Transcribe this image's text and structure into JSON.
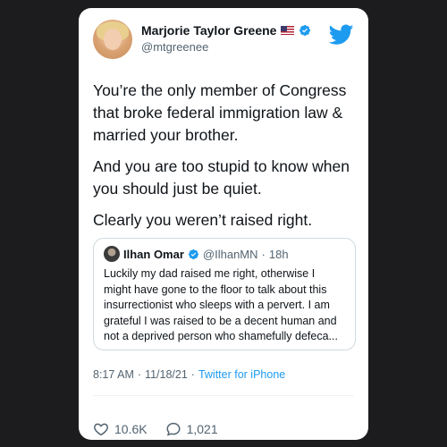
{
  "tweet": {
    "author_name": "Marjorie Taylor Greene",
    "author_handle": "@mtgreenee",
    "paragraphs": [
      "You’re the only member of Congress that broke federal immigration law & married your brother.",
      "And you are too stupid to know when you should just be quiet.",
      "Clearly you weren’t raised right."
    ],
    "time": "8:17 AM",
    "date": "11/18/21",
    "sep": "·",
    "source": "Twitter for iPhone",
    "likes": "10.6K",
    "replies": "1,021"
  },
  "quoted": {
    "author_name": "Ilhan Omar",
    "author_handle": "@IlhanMN",
    "age": "18h",
    "sep": "·",
    "text": "Luckily my dad raised me right, otherwise I might have gone to the floor to talk about this insurrectionist who sleeps with a pervert. I am grateful I was raised to be a decent human and not a deprived person who shamefully defeca..."
  },
  "icons": {
    "brand": "twitter-bird-icon",
    "verified": "verified-badge-icon",
    "flag": "us-flag-icon",
    "like": "heart-icon",
    "reply": "speech-bubble-icon"
  },
  "colors": {
    "brand_blue": "#1d9bf0",
    "background": "#1c1c1e",
    "card": "#ffffff"
  }
}
